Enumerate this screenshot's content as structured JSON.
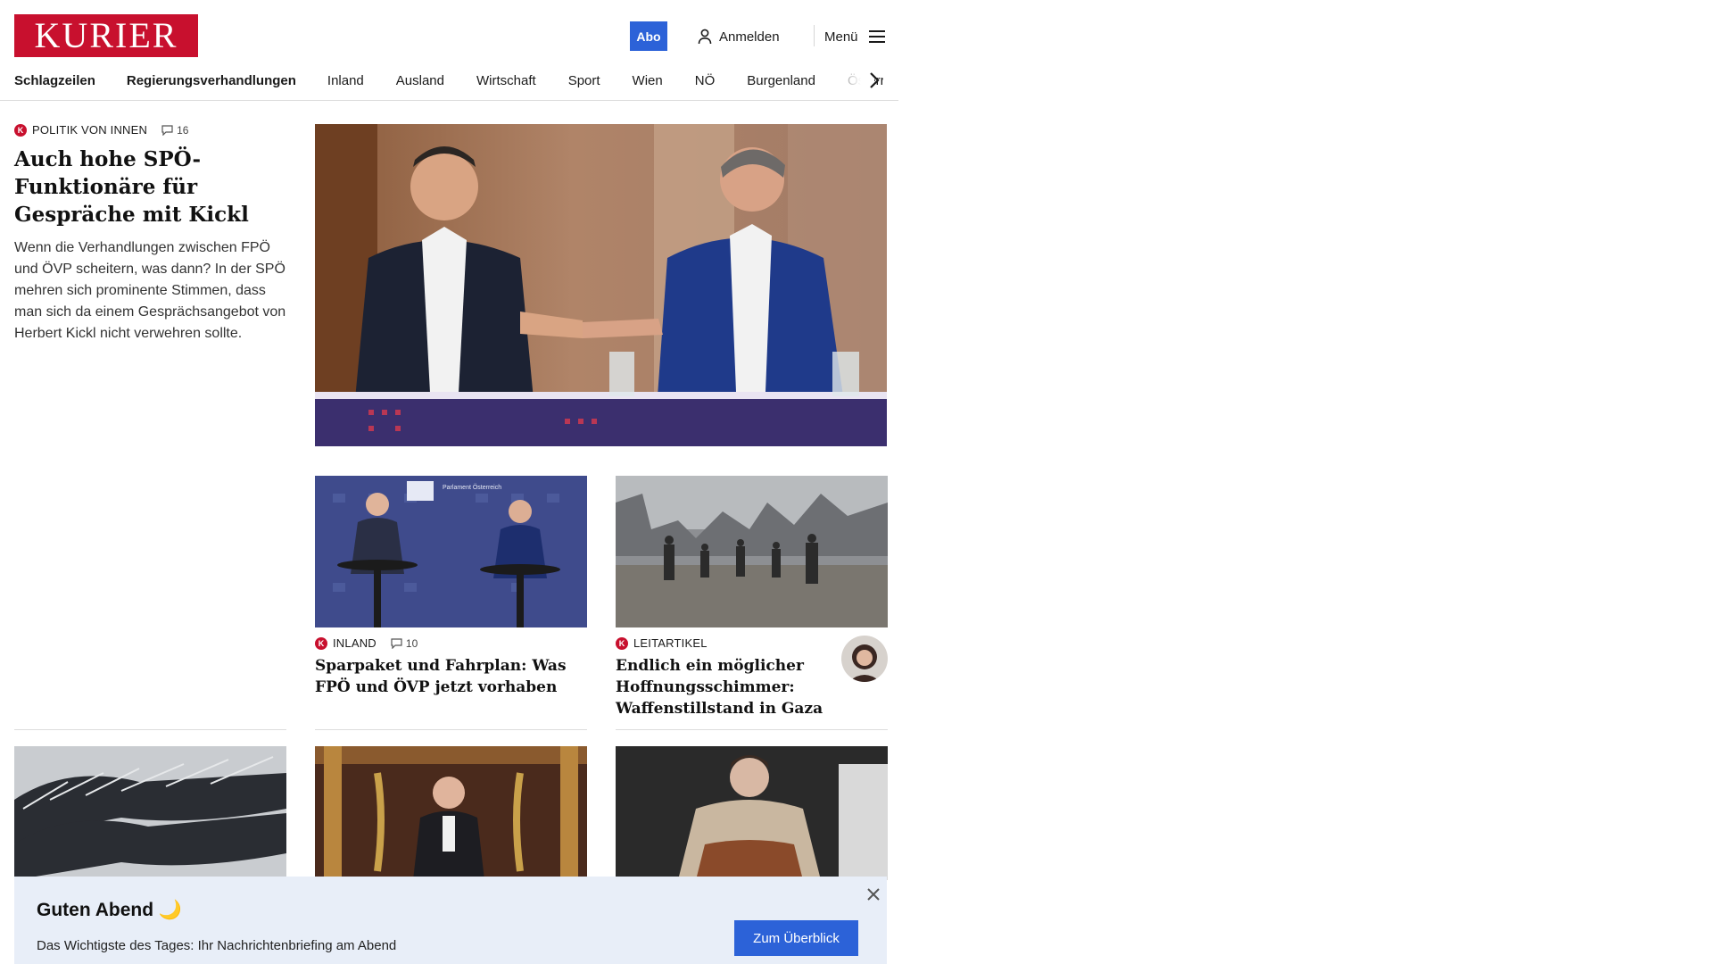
{
  "header": {
    "logo_text": "KURIER",
    "abo_label": "Abo",
    "login_label": "Anmelden",
    "menu_label": "Menü",
    "brand_color": "#c8102e",
    "accent_color": "#2c62d8"
  },
  "nav": {
    "items": [
      "Schlagzeilen",
      "Regierungsverhandlungen",
      "Inland",
      "Ausland",
      "Wirtschaft",
      "Sport",
      "Wien",
      "NÖ",
      "Burgenland",
      "Österreich"
    ]
  },
  "lead": {
    "kicker": "Politik von innen",
    "comments": "16",
    "title": "Auch hohe SPÖ-Funktio­näre für Gespräche mit Kickl",
    "teaser": "Wenn die Verhandlungen zwischen FPÖ und ÖVP scheitern, was dann? In der SPÖ mehren sich prominente Stimmen, dass man sich da einem Gesprächsangebot von Herbert Kickl nicht verwehren sollte."
  },
  "cards": [
    {
      "kicker": "Inland",
      "comments": "10",
      "title": "Sparpaket und Fahrplan: Was FPÖ und ÖVP jetzt vorhaben"
    },
    {
      "kicker": "Leitartikel",
      "title": "Endlich ein möglicher Hoffnungsschimmer: Waf­fenstillstand in Gaza"
    }
  ],
  "image_texts": {
    "parliament_sign": "Parlament Österreich"
  },
  "banner": {
    "greeting": "Guten Abend 🌙",
    "subtitle": "Das Wichtigste des Tages: Ihr Nachrichtenbriefing am Abend",
    "cta_label": "Zum Überblick"
  }
}
